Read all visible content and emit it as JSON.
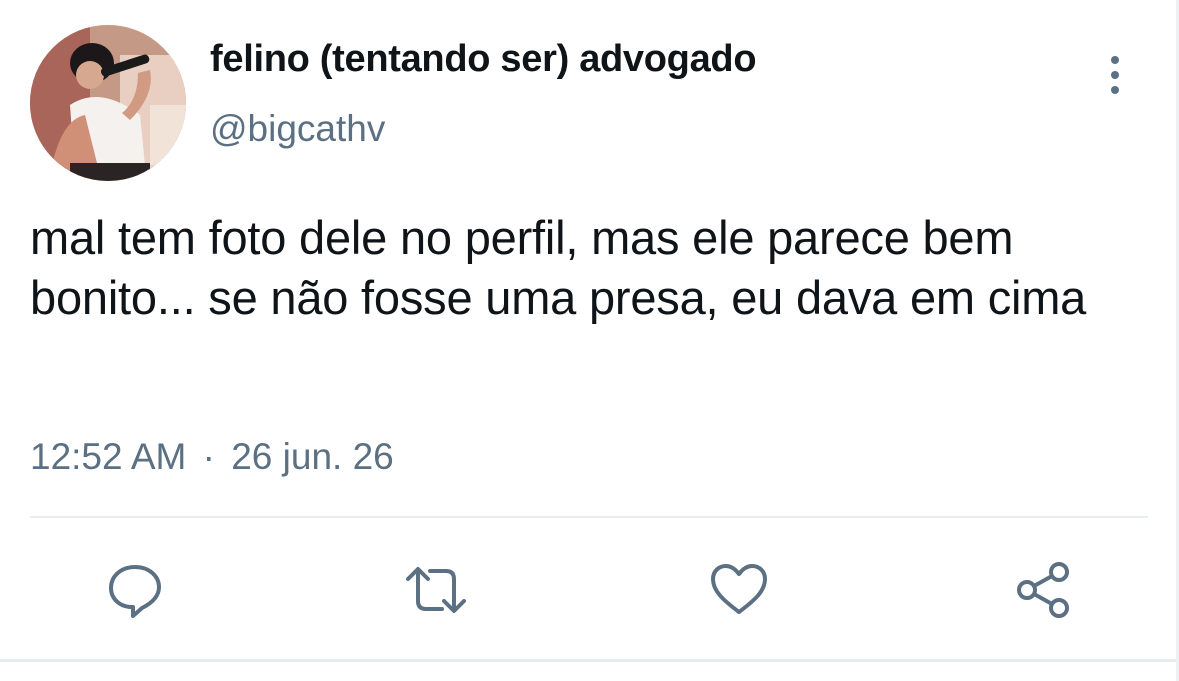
{
  "user": {
    "display_name": "felino (tentando ser) advogado",
    "handle": "@bigcathv",
    "avatar": "profile-photo"
  },
  "tweet": {
    "text": "mal tem foto dele no perfil, mas ele parece bem bonito... se não fosse uma presa, eu dava em cima",
    "time": "12:52 AM",
    "separator": "·",
    "date": "26 jun. 26"
  },
  "icons": {
    "more": "more-vertical-icon",
    "reply": "reply-icon",
    "retweet": "retweet-icon",
    "like": "heart-icon",
    "share": "share-icon"
  },
  "colors": {
    "text": "#0f1419",
    "secondary": "#5b7083",
    "divider": "#e6ecf0"
  }
}
